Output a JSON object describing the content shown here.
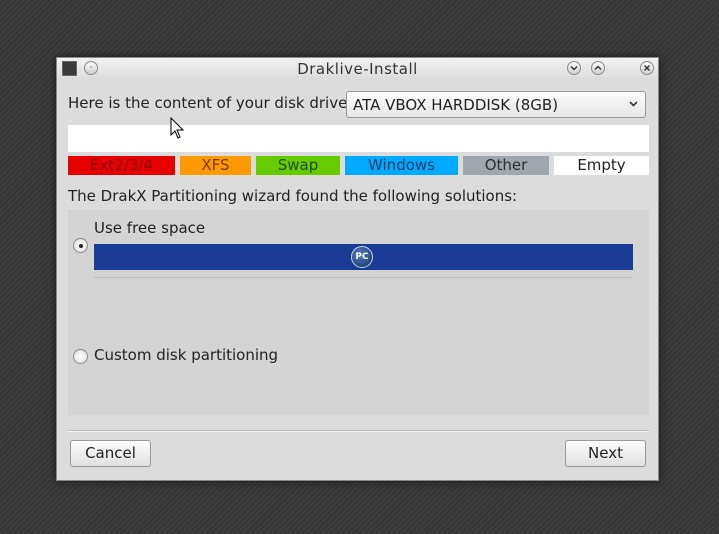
{
  "window": {
    "title": "Draklive-Install"
  },
  "drive": {
    "label": "Here is the content of your disk drive",
    "selected": "ATA VBOX HARDDISK (8GB)"
  },
  "legend": [
    {
      "label": "Ext2/3/4",
      "color": "#e60000",
      "text_color": "#8b0000"
    },
    {
      "label": "XFS",
      "color": "#ff9900",
      "text_color": "#7a3a00"
    },
    {
      "label": "Swap",
      "color": "#66cc00",
      "text_color": "#1f4d00"
    },
    {
      "label": "Windows",
      "color": "#00aaff",
      "text_color": "#003d66"
    },
    {
      "label": "Other",
      "color": "#a0a6ae",
      "text_color": "#2e2e2e"
    },
    {
      "label": "Empty",
      "color": "#ffffff",
      "text_color": "#222222"
    }
  ],
  "wizard": {
    "message": "The DrakX Partitioning wizard found the following solutions:",
    "options": [
      {
        "label": "Use free space",
        "selected": true
      },
      {
        "label": "Custom disk partitioning",
        "selected": false
      }
    ],
    "partition_bar_color": "#1a3c96",
    "partition_icon": "pclinuxos-logo-icon",
    "partition_icon_text": "PC"
  },
  "buttons": {
    "cancel": "Cancel",
    "next": "Next"
  },
  "icons": {
    "app": "app-icon",
    "help": "help-icon",
    "minimize": "chevron-down-icon",
    "maximize": "chevron-up-icon",
    "close": "close-icon",
    "dropdown": "chevron-down-icon"
  }
}
